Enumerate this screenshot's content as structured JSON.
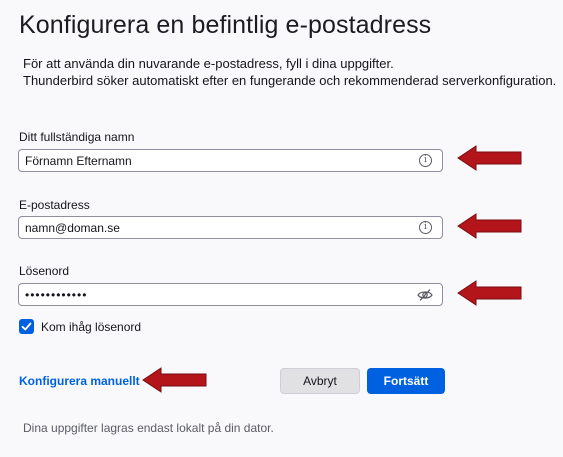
{
  "page": {
    "title": "Konfigurera en befintlig e-postadress",
    "description_line1": "För att använda din nuvarande e-postadress, fyll i dina uppgifter.",
    "description_line2": "Thunderbird söker automatiskt efter en fungerande och rekommenderad serverkonfiguration."
  },
  "form": {
    "name_label": "Ditt fullständiga namn",
    "name_value": "Förnamn Efternamn",
    "email_label": "E-postadress",
    "email_value": "namn@doman.se",
    "password_label": "Lösenord",
    "password_value": "••••••••••••",
    "remember_label": "Kom ihåg lösenord",
    "remember_checked": true
  },
  "actions": {
    "manual_link": "Konfigurera manuellt",
    "cancel_label": "Avbryt",
    "continue_label": "Fortsätt"
  },
  "footer": {
    "note": "Dina uppgifter lagras endast lokalt på din dator."
  },
  "icons": {
    "info": "info-icon",
    "eye": "eye-slash-icon",
    "checkmark": "checkmark-icon",
    "arrow": "red-arrow-icon"
  },
  "colors": {
    "accent": "#0061e0",
    "annotation_arrow": "#b3151b"
  }
}
